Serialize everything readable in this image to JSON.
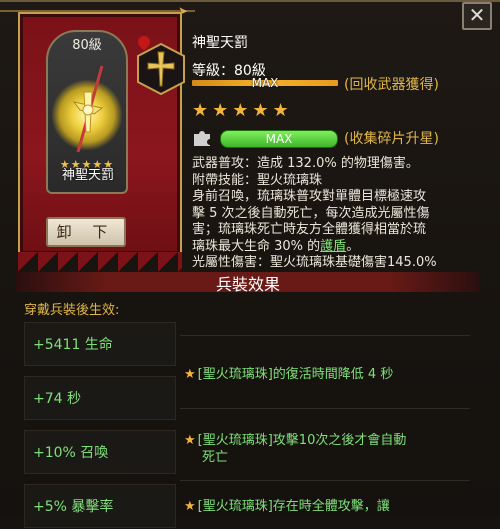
{
  "weapon": {
    "name": "神聖天罰",
    "level_badge": "80級",
    "card_stars": "★★★★★",
    "unequip_label": "卸 下"
  },
  "info": {
    "title": "神聖天罰",
    "level_text": "等級：80級",
    "max_label": "MAX",
    "recycle_text": "(回收武器獲得)",
    "stars": "★★★★★",
    "fragment_max_label": "MAX",
    "fragment_text": "(收集碎片升星)",
    "description_lines": [
      "武器普攻：造成 132.0% 的物理傷害。",
      "附帶技能：聖火琉璃珠",
      "身前召喚，琉璃珠普攻對單體目標極速攻",
      "擊 5 次之後自動死亡，每次造成光屬性傷",
      "害；琉璃珠死亡時友方全體獲得相當於琉",
      "璃珠最大生命 30% 的",
      "護盾",
      "。",
      "光屬性傷害：聖火琉璃珠基礎傷害145.0%"
    ]
  },
  "section": {
    "title": "兵裝效果",
    "subtitle": "穿戴兵裝後生效:"
  },
  "bonuses": [
    {
      "stat": "+5411 生命"
    },
    {
      "stat": "+74 秒"
    },
    {
      "stat": "+10% 召喚"
    },
    {
      "stat": "+5% 暴擊率"
    }
  ],
  "effects": [
    {
      "line1": "[聖火琉璃珠]的復活時間降低 4 秒",
      "line2": ""
    },
    {
      "line1": "[聖火琉璃珠]攻擊10次之後才會自動",
      "line2": "死亡"
    },
    {
      "line1": "[聖火琉璃珠]存在時全體攻擊，讓",
      "line2": ""
    }
  ],
  "close_label": "✕",
  "colors": {
    "gold": "#e0b64a",
    "green": "#7fe07a",
    "banner": "#8c161e"
  }
}
